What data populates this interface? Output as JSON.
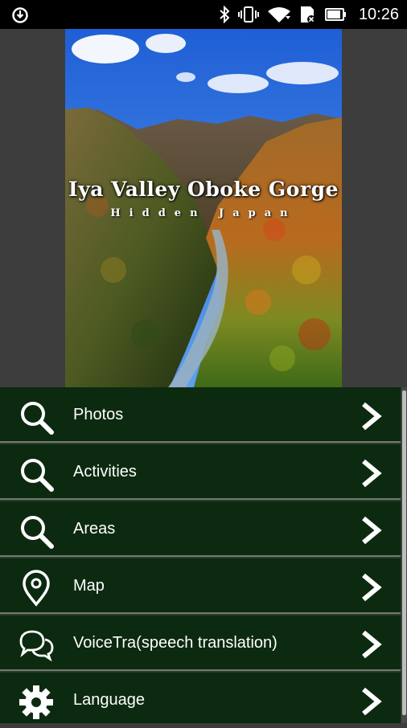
{
  "status_bar": {
    "time": "10:26",
    "icons": [
      "sync-icon",
      "bluetooth-icon",
      "vibrate-icon",
      "wifi-icon",
      "sim-icon",
      "battery-icon"
    ]
  },
  "hero": {
    "title": "Iya Valley Oboke Gorge",
    "subtitle": "Hidden Japan"
  },
  "menu": {
    "items": [
      {
        "label": "Photos",
        "icon": "search-icon"
      },
      {
        "label": "Activities",
        "icon": "search-icon"
      },
      {
        "label": "Areas",
        "icon": "search-icon"
      },
      {
        "label": "Map",
        "icon": "map-pin-icon"
      },
      {
        "label": "VoiceTra(speech translation)",
        "icon": "speech-bubbles-icon"
      },
      {
        "label": "Language",
        "icon": "gear-icon"
      }
    ]
  },
  "colors": {
    "menu_background": "#0c2a10",
    "divider": "#6f7c6f",
    "status_bar": "#000000",
    "side_background": "#3d3d3d"
  }
}
